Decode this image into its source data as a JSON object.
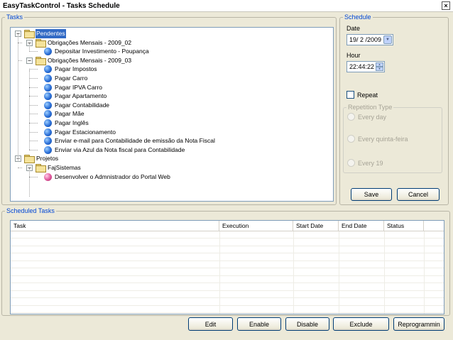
{
  "window": {
    "title": "EasyTaskControl - Tasks Schedule",
    "close_glyph": "×"
  },
  "tasks": {
    "legend": "Tasks",
    "tree": [
      {
        "label": "Pendentes",
        "type": "folder",
        "level": 0,
        "expander": "−",
        "selected": true
      },
      {
        "label": "Obrigações Mensais - 2009_02",
        "type": "folder",
        "level": 1,
        "expander": "−"
      },
      {
        "label": "Depositar Investimento - Poupança",
        "type": "task",
        "level": 2
      },
      {
        "label": "Obrigações Mensais - 2009_03",
        "type": "folder",
        "level": 1,
        "expander": "−"
      },
      {
        "label": "Pagar Impostos",
        "type": "task",
        "level": 2
      },
      {
        "label": "Pagar Carro",
        "type": "task",
        "level": 2
      },
      {
        "label": "Pagar IPVA Carro",
        "type": "task",
        "level": 2
      },
      {
        "label": "Pagar Apartamento",
        "type": "task",
        "level": 2
      },
      {
        "label": "Pagar Contabilidade",
        "type": "task",
        "level": 2
      },
      {
        "label": "Pagar Mãe",
        "type": "task",
        "level": 2
      },
      {
        "label": "Pagar Inglês",
        "type": "task",
        "level": 2
      },
      {
        "label": "Pagar Estacionamento",
        "type": "task",
        "level": 2
      },
      {
        "label": "Enviar e-mail para Contabilidade de emissão da Nota Fiscal",
        "type": "task",
        "level": 2
      },
      {
        "label": "Enviar via Azul da Nota fiscal para Contabilidade",
        "type": "task",
        "level": 2
      },
      {
        "label": "Projetos",
        "type": "folder",
        "level": 0,
        "expander": "−"
      },
      {
        "label": "FajSistemas",
        "type": "folder",
        "level": 1,
        "expander": "−"
      },
      {
        "label": "Desenvolver o Admnistrador do Portal Web",
        "type": "task-pink",
        "level": 2
      }
    ]
  },
  "schedule": {
    "legend": "Schedule",
    "date_label": "Date",
    "date_value": "19/ 2 /2009",
    "hour_label": "Hour",
    "hour_value": "22:44:22",
    "repeat_label": "Repeat",
    "repetition_legend": "Repetition Type",
    "options": [
      "Every day",
      "Every  quinta-feira",
      "Every  19"
    ],
    "save_label": "Save",
    "cancel_label": "Cancel"
  },
  "scheduled": {
    "legend": "Scheduled Tasks",
    "columns": [
      "Task",
      "Execution",
      "Start Date",
      "End Date",
      "Status"
    ]
  },
  "actions": {
    "edit": "Edit",
    "enable": "Enable",
    "disable": "Disable",
    "exclude": "Exclude",
    "reprogram": "Reprogrammin"
  }
}
